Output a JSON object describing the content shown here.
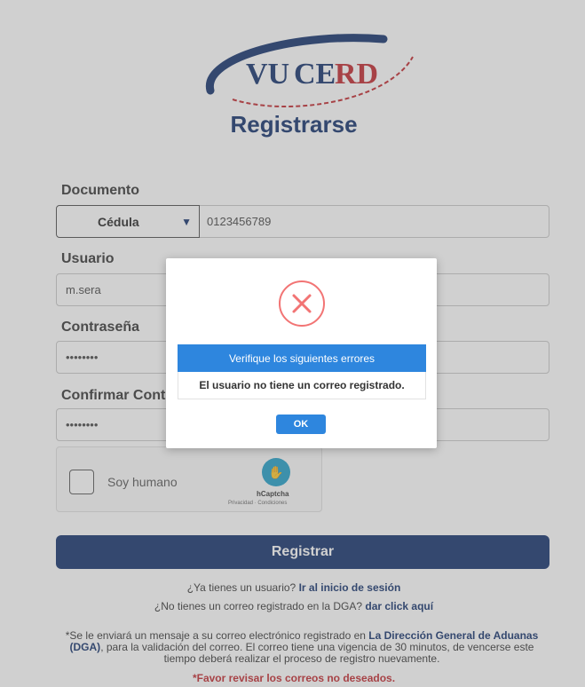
{
  "brand": {
    "logo_text_v": "VU",
    "logo_text_ce": "CE",
    "logo_text_rd": "RD",
    "primary_color": "#102f6a",
    "accent_color": "#c0262c"
  },
  "page": {
    "title": "Registrarse"
  },
  "form": {
    "documento_label": "Documento",
    "doc_type_selected": "Cédula",
    "doc_number_value": "0123456789",
    "usuario_label": "Usuario",
    "usuario_value": "m.sera",
    "contrasena_label": "Contraseña",
    "contrasena_value": "••••••••",
    "confirmar_label": "Confirmar Contraseña",
    "confirmar_value": "••••••••"
  },
  "captcha": {
    "checkbox_label": "Soy humano",
    "provider": "hCaptcha",
    "links": "Privacidad · Condiciones",
    "icon": "hand-icon"
  },
  "actions": {
    "register_label": "Registrar"
  },
  "info": {
    "have_user_text": "¿Ya tienes un usuario?",
    "login_link": "Ir al inicio de sesión",
    "no_email_text": "¿No tienes un correo registrado en la DGA?",
    "click_link": "dar click aquí",
    "notice_part1": "*Se le enviará un mensaje a su correo electrónico registrado en",
    "notice_org": "La Dirección General de Aduanas (DGA)",
    "notice_part2": ", para la validación del correo. El correo tiene una vigencia de 30 minutos, de vencerse este tiempo deberá realizar el proceso de registro nuevamente.",
    "spam_warning": "*Favor revisar los correos no deseados."
  },
  "modal": {
    "icon": "error-x-icon",
    "header": "Verifique los siguientes errores",
    "message": "El usuario no tiene un correo registrado.",
    "ok_label": "OK"
  }
}
